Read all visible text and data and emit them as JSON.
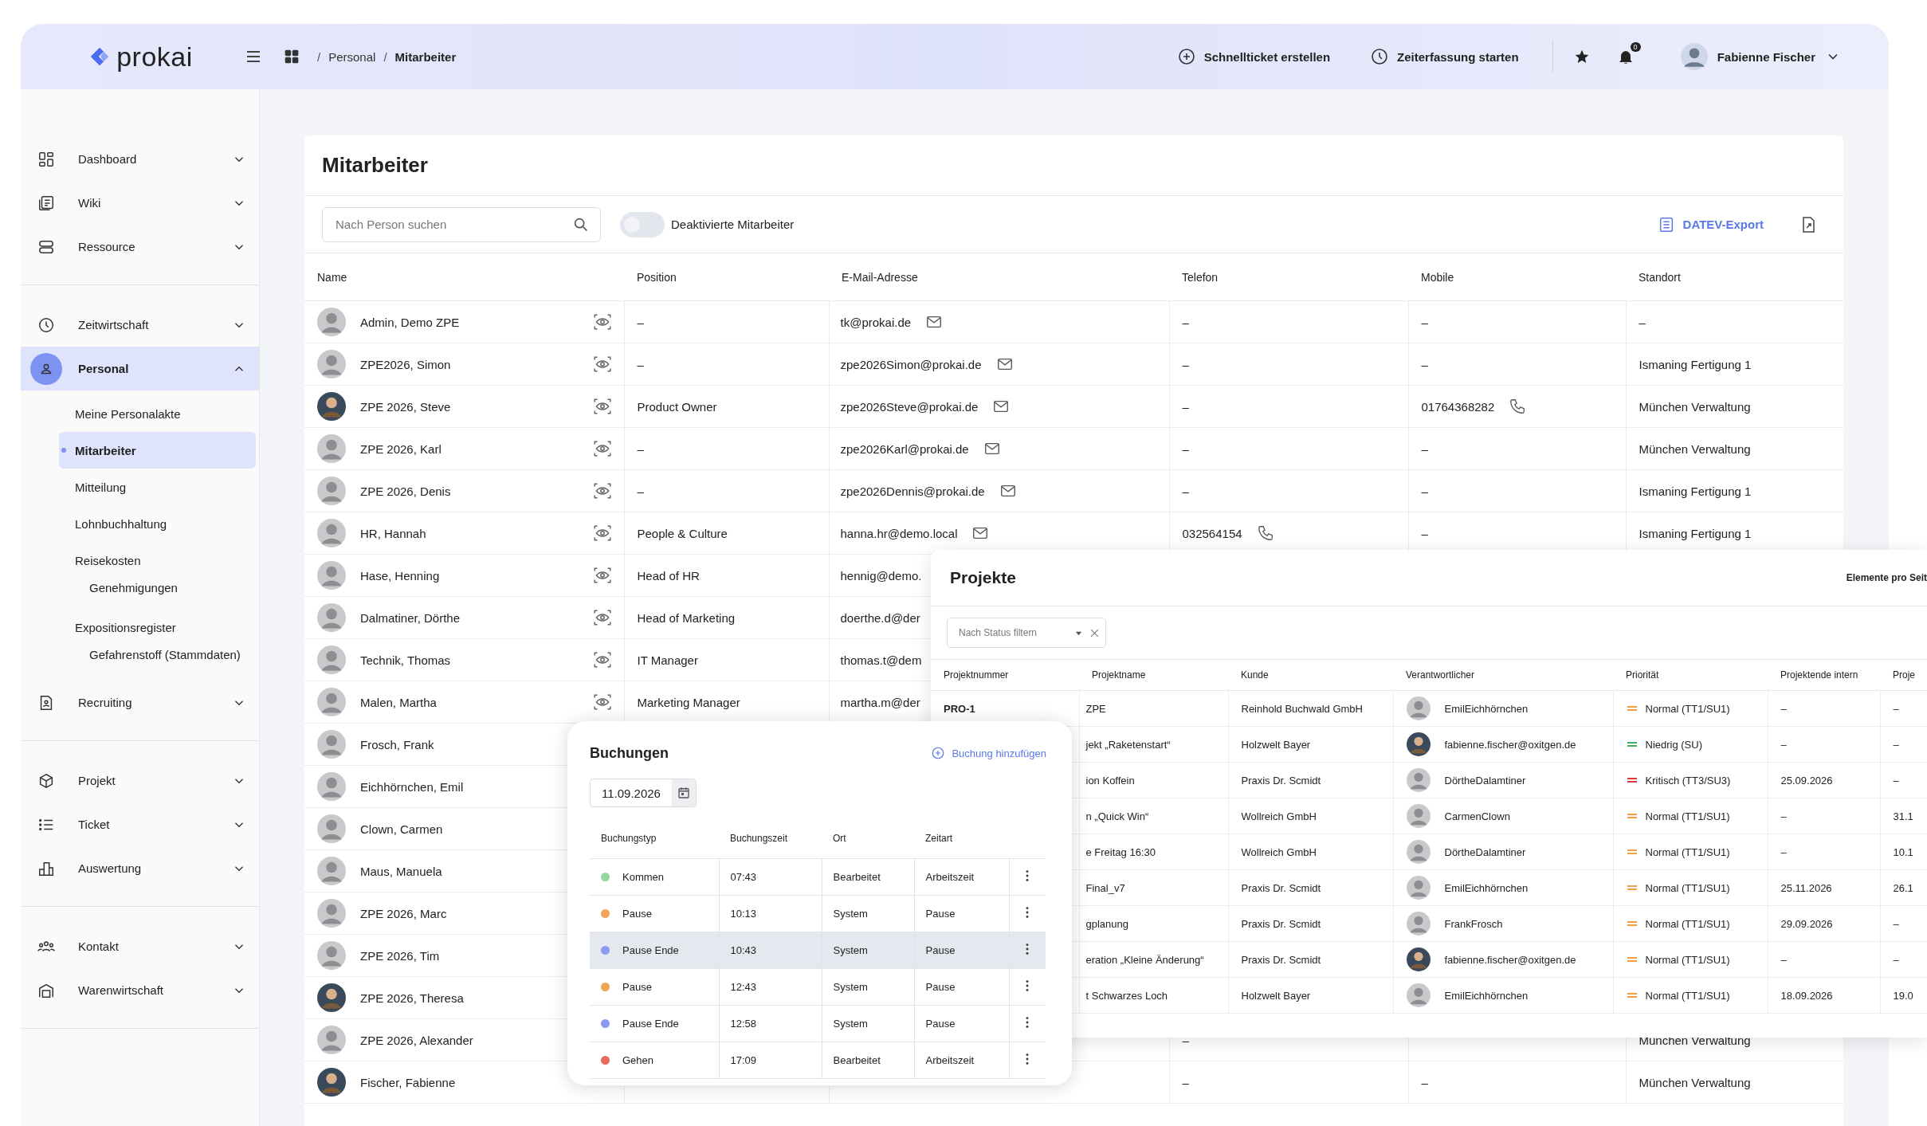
{
  "header": {
    "logo": "prokai",
    "breadcrumb": [
      {
        "kind": "sep",
        "text": "/"
      },
      {
        "kind": "link",
        "text": "Personal"
      },
      {
        "kind": "sep",
        "text": "/"
      },
      {
        "kind": "current",
        "text": "Mitarbeiter"
      }
    ],
    "actions": [
      "Schnellticket erstellen",
      "Zeiterfassung starten"
    ],
    "notifications": {
      "badge": "0"
    },
    "user": {
      "name": "Fabienne Fischer"
    }
  },
  "sidebar": {
    "groups": [
      {
        "items": [
          {
            "label": "Dashboard",
            "expanded": false,
            "selected": false
          },
          {
            "label": "Wiki",
            "expanded": false,
            "selected": false
          },
          {
            "label": "Ressource",
            "expanded": false,
            "selected": false
          }
        ]
      },
      {
        "items": [
          {
            "label": "Zeitwirtschaft",
            "expanded": false,
            "selected": false
          },
          {
            "label": "Personal",
            "expanded": true,
            "selected": true,
            "children": [
              {
                "label": "Meine Personalakte",
                "selected": false
              },
              {
                "label": "Mitarbeiter",
                "selected": true
              },
              {
                "label": "Mitteilung",
                "selected": false
              },
              {
                "label": "Lohnbuchhaltung",
                "selected": false
              },
              {
                "label": "Reisekosten",
                "selected": false,
                "children": [
                  {
                    "label": "Genehmigungen",
                    "selected": false
                  }
                ]
              },
              {
                "label": "Expositionsregister",
                "selected": false,
                "children": [
                  {
                    "label": "Gefahrenstoff (Stammdaten)",
                    "selected": false
                  }
                ]
              }
            ]
          },
          {
            "label": "Recruiting",
            "expanded": false,
            "selected": false
          }
        ]
      },
      {
        "items": [
          {
            "label": "Projekt",
            "expanded": false,
            "selected": false
          },
          {
            "label": "Ticket",
            "expanded": false,
            "selected": false
          },
          {
            "label": "Auswertung",
            "expanded": false,
            "selected": false
          }
        ]
      },
      {
        "items": [
          {
            "label": "Kontakt",
            "expanded": false,
            "selected": false
          },
          {
            "label": "Warenwirtschaft",
            "expanded": false,
            "selected": false
          }
        ]
      }
    ]
  },
  "page": {
    "title": "Mitarbeiter",
    "search": {
      "placeholder": "Nach Person suchen"
    },
    "toggle": {
      "label": "Deaktivierte Mitarbeiter",
      "on": false
    },
    "export": "DATEV-Export",
    "columns": [
      "Name",
      "Position",
      "E-Mail-Adresse",
      "Telefon",
      "Mobile",
      "Standort"
    ],
    "rows": [
      {
        "name": "Admin, Demo ZPE",
        "photo": false,
        "view": true,
        "position": "–",
        "email": "tk@prokai.de",
        "email_action": true,
        "telefon": "–",
        "mobile": "–",
        "standort": "–"
      },
      {
        "name": "ZPE2026, Simon",
        "photo": false,
        "view": true,
        "position": "–",
        "email": "zpe2026Simon@prokai.de",
        "email_action": true,
        "telefon": "–",
        "mobile": "–",
        "standort": "Ismaning Fertigung 1"
      },
      {
        "name": "ZPE 2026, Steve",
        "photo": true,
        "view": true,
        "position": "Product Owner",
        "email": "zpe2026Steve@prokai.de",
        "email_action": true,
        "telefon": "–",
        "mobile": "01764368282",
        "mobile_call": true,
        "standort": "München Verwaltung"
      },
      {
        "name": "ZPE 2026, Karl",
        "photo": false,
        "view": true,
        "position": "–",
        "email": "zpe2026Karl@prokai.de",
        "email_action": true,
        "telefon": "–",
        "mobile": "–",
        "standort": "München Verwaltung"
      },
      {
        "name": "ZPE 2026, Denis",
        "photo": false,
        "view": true,
        "position": "–",
        "email": "zpe2026Dennis@prokai.de",
        "email_action": true,
        "telefon": "–",
        "mobile": "–",
        "standort": "Ismaning Fertigung 1"
      },
      {
        "name": "HR, Hannah",
        "photo": false,
        "view": true,
        "position": "People & Culture",
        "email": "hanna.hr@demo.local",
        "email_action": true,
        "telefon": "032564154",
        "telefon_call": true,
        "mobile": "–",
        "standort": "Ismaning Fertigung 1"
      },
      {
        "name": "Hase, Henning",
        "photo": false,
        "view": true,
        "position": "Head of HR",
        "email": "hennig@demo."
      },
      {
        "name": "Dalmatiner, Dörthe",
        "photo": false,
        "view": true,
        "position": "Head of Marketing",
        "email": "doerthe.d@der"
      },
      {
        "name": "Technik, Thomas",
        "photo": false,
        "view": true,
        "position": "IT Manager",
        "email": "thomas.t@dem"
      },
      {
        "name": "Malen, Martha",
        "photo": false,
        "view": true,
        "position": "Marketing Manager",
        "email": "martha.m@der"
      },
      {
        "name": "Frosch, Frank",
        "photo": false
      },
      {
        "name": "Eichhörnchen, Emil",
        "photo": false
      },
      {
        "name": "Clown, Carmen",
        "photo": false
      },
      {
        "name": "Maus, Manuela",
        "photo": false
      },
      {
        "name": "ZPE 2026, Marc",
        "photo": false
      },
      {
        "name": "ZPE 2026, Tim",
        "photo": false
      },
      {
        "name": "ZPE 2026, Theresa",
        "photo": true
      },
      {
        "name": "ZPE 2026, Alexander",
        "photo": false,
        "telefon": "–",
        "standort": "München Verwaltung"
      },
      {
        "name": "Fischer, Fabienne",
        "photo": true,
        "telefon": "–",
        "mobile": "–",
        "standort": "München Verwaltung"
      }
    ]
  },
  "projekte": {
    "title": "Projekte",
    "per_page": "Elemente pro Seit",
    "filter": {
      "placeholder": "Nach Status filtern"
    },
    "columns": [
      "Projektnummer",
      "Projektname",
      "Kunde",
      "Verantwortlicher",
      "Priorität",
      "Projektende intern",
      "Proje"
    ],
    "rows": [
      {
        "nummer": "PRO-1",
        "name": "ZPE",
        "kunde": "Reinhold Buchwald GmbH",
        "owner": "EmilEichhörnchen",
        "photo": false,
        "prio": "Normal (TT1/SU1)",
        "color": "#f0a040",
        "ende": "–",
        "last": "–"
      },
      {
        "name": "jekt „Raketenstart“",
        "kunde": "Holzwelt Bayer",
        "owner": "fabienne.fischer@oxitgen.de",
        "photo": true,
        "prio": "Niedrig (SU)",
        "color": "#3fae5a",
        "ende": "–",
        "last": "–"
      },
      {
        "name": "ion Koffein",
        "kunde": "Praxis Dr. Scmidt",
        "owner": "DörtheDalamtiner",
        "photo": false,
        "prio": "Kritisch (TT3/SU3)",
        "color": "#d9363e",
        "ende": "25.09.2026",
        "last": "–"
      },
      {
        "name": "n „Quick Win“",
        "kunde": "Wollreich GmbH",
        "owner": "CarmenClown",
        "photo": false,
        "prio": "Normal (TT1/SU1)",
        "color": "#f0a040",
        "ende": "–",
        "last": "31.1"
      },
      {
        "name": "e Freitag 16:30",
        "kunde": "Wollreich GmbH",
        "owner": "DörtheDalamtiner",
        "photo": false,
        "prio": "Normal (TT1/SU1)",
        "color": "#f0a040",
        "ende": "–",
        "last": "10.1"
      },
      {
        "name": "Final_v7",
        "kunde": "Praxis Dr. Scmidt",
        "owner": "EmilEichhörnchen",
        "photo": false,
        "prio": "Normal (TT1/SU1)",
        "color": "#f0a040",
        "ende": "25.11.2026",
        "last": "26.1"
      },
      {
        "name": "gplanung",
        "kunde": "Praxis Dr. Scmidt",
        "owner": "FrankFrosch",
        "photo": false,
        "prio": "Normal (TT1/SU1)",
        "color": "#f0a040",
        "ende": "29.09.2026",
        "last": "–"
      },
      {
        "name": "eration „Kleine Änderung“",
        "kunde": "Praxis Dr. Scmidt",
        "owner": "fabienne.fischer@oxitgen.de",
        "photo": true,
        "prio": "Normal (TT1/SU1)",
        "color": "#f0a040",
        "ende": "–",
        "last": "–"
      },
      {
        "name": "t Schwarzes Loch",
        "kunde": "Holzwelt Bayer",
        "owner": "EmilEichhörnchen",
        "photo": false,
        "prio": "Normal (TT1/SU1)",
        "color": "#f0a040",
        "ende": "18.09.2026",
        "last": "19.0"
      }
    ]
  },
  "buchungen": {
    "title": "Buchungen",
    "add": "Buchung hinzufügen",
    "date": "11.09.2026",
    "columns": [
      "Buchungstyp",
      "Buchungszeit",
      "Ort",
      "Zeitart"
    ],
    "rows": [
      {
        "typ": "Kommen",
        "color": "#93d8a0",
        "zeit": "07:43",
        "ort": "Bearbeitet",
        "zeitart": "Arbeitszeit",
        "selected": false
      },
      {
        "typ": "Pause",
        "color": "#eea557",
        "zeit": "10:13",
        "ort": "System",
        "zeitart": "Pause",
        "selected": false
      },
      {
        "typ": "Pause Ende",
        "color": "#8c9bef",
        "zeit": "10:43",
        "ort": "System",
        "zeitart": "Pause",
        "selected": true
      },
      {
        "typ": "Pause",
        "color": "#eea557",
        "zeit": "12:43",
        "ort": "System",
        "zeitart": "Pause",
        "selected": false
      },
      {
        "typ": "Pause Ende",
        "color": "#8c9bef",
        "zeit": "12:58",
        "ort": "System",
        "zeitart": "Pause",
        "selected": false
      },
      {
        "typ": "Gehen",
        "color": "#e86a5f",
        "zeit": "17:09",
        "ort": "Bearbeitet",
        "zeitart": "Arbeitszeit",
        "selected": false
      }
    ]
  }
}
